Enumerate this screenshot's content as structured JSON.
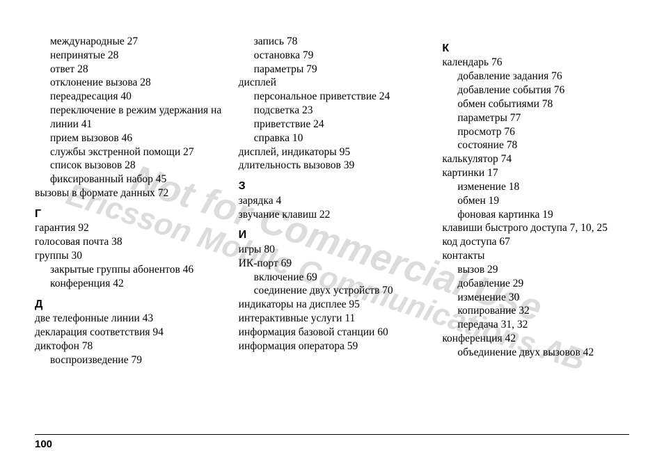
{
  "watermark": {
    "line1": "Not for Commercial Use",
    "line2": "Ericsson Mobile Communications AB"
  },
  "page_number": "100",
  "columns": [
    [
      {
        "kind": "entry",
        "indent": 1,
        "text": "международные 27"
      },
      {
        "kind": "entry",
        "indent": 1,
        "text": "непринятые 28"
      },
      {
        "kind": "entry",
        "indent": 1,
        "text": "ответ 28"
      },
      {
        "kind": "entry",
        "indent": 1,
        "text": "отклонение вызова 28"
      },
      {
        "kind": "entry",
        "indent": 1,
        "text": "переадресация 40"
      },
      {
        "kind": "entry",
        "indent": 1,
        "text": "переключение в режим удержания на линии 41"
      },
      {
        "kind": "entry",
        "indent": 1,
        "text": "прием вызовов 46"
      },
      {
        "kind": "entry",
        "indent": 1,
        "text": "службы экстренной помощи 27"
      },
      {
        "kind": "entry",
        "indent": 1,
        "text": "список вызовов 28"
      },
      {
        "kind": "entry",
        "indent": 1,
        "text": "фиксированный набор 45"
      },
      {
        "kind": "entry",
        "indent": 0,
        "text": "вызовы в формате данных 72"
      },
      {
        "kind": "letter",
        "text": "Г"
      },
      {
        "kind": "entry",
        "indent": 0,
        "text": "гарантия 92"
      },
      {
        "kind": "entry",
        "indent": 0,
        "text": "голосовая почта 38"
      },
      {
        "kind": "entry",
        "indent": 0,
        "text": "группы 30"
      },
      {
        "kind": "entry",
        "indent": 1,
        "text": "закрытые группы абонентов 46"
      },
      {
        "kind": "entry",
        "indent": 1,
        "text": "конференция 42"
      },
      {
        "kind": "letter",
        "text": "Д"
      },
      {
        "kind": "entry",
        "indent": 0,
        "text": "две телефонные линии 43"
      },
      {
        "kind": "entry",
        "indent": 0,
        "text": "декларация соответствия 94"
      },
      {
        "kind": "entry",
        "indent": 0,
        "text": "диктофон 78"
      },
      {
        "kind": "entry",
        "indent": 1,
        "text": "воспроизведение 79"
      }
    ],
    [
      {
        "kind": "entry",
        "indent": 1,
        "text": "запись 78"
      },
      {
        "kind": "entry",
        "indent": 1,
        "text": "остановка 79"
      },
      {
        "kind": "entry",
        "indent": 1,
        "text": "параметры 79"
      },
      {
        "kind": "entry",
        "indent": 0,
        "text": "дисплей"
      },
      {
        "kind": "entry",
        "indent": 1,
        "text": "персональное приветствие 24"
      },
      {
        "kind": "entry",
        "indent": 1,
        "text": "подсветка 23"
      },
      {
        "kind": "entry",
        "indent": 1,
        "text": "приветствие 24"
      },
      {
        "kind": "entry",
        "indent": 1,
        "text": "справка 10"
      },
      {
        "kind": "entry",
        "indent": 0,
        "text": "дисплей, индикаторы 95"
      },
      {
        "kind": "entry",
        "indent": 0,
        "text": "длительность вызовов 39"
      },
      {
        "kind": "letter",
        "text": "З"
      },
      {
        "kind": "entry",
        "indent": 0,
        "text": "зарядка 4"
      },
      {
        "kind": "entry",
        "indent": 0,
        "text": "звучание клавиш 22"
      },
      {
        "kind": "letter",
        "text": "И"
      },
      {
        "kind": "entry",
        "indent": 0,
        "text": "игры 80"
      },
      {
        "kind": "entry",
        "indent": 0,
        "text": "ИК-порт 69"
      },
      {
        "kind": "entry",
        "indent": 1,
        "text": "включение 69"
      },
      {
        "kind": "entry",
        "indent": 1,
        "text": "соединение двух устройств 70"
      },
      {
        "kind": "entry",
        "indent": 0,
        "text": "индикаторы на дисплее 95"
      },
      {
        "kind": "entry",
        "indent": 0,
        "text": "интерактивные услуги 11"
      },
      {
        "kind": "entry",
        "indent": 0,
        "text": "информация базовой станции 60"
      },
      {
        "kind": "entry",
        "indent": 0,
        "text": "информация оператора 59"
      }
    ],
    [
      {
        "kind": "letter",
        "text": "К"
      },
      {
        "kind": "entry",
        "indent": 0,
        "text": "календарь 76"
      },
      {
        "kind": "entry",
        "indent": 1,
        "text": "добавление задания 76"
      },
      {
        "kind": "entry",
        "indent": 1,
        "text": "добавление события 76"
      },
      {
        "kind": "entry",
        "indent": 1,
        "text": "обмен событиями 78"
      },
      {
        "kind": "entry",
        "indent": 1,
        "text": "параметры 77"
      },
      {
        "kind": "entry",
        "indent": 1,
        "text": "просмотр 76"
      },
      {
        "kind": "entry",
        "indent": 1,
        "text": "состояние 78"
      },
      {
        "kind": "entry",
        "indent": 0,
        "text": "калькулятор 74"
      },
      {
        "kind": "entry",
        "indent": 0,
        "text": "картинки 17"
      },
      {
        "kind": "entry",
        "indent": 1,
        "text": "изменение 18"
      },
      {
        "kind": "entry",
        "indent": 1,
        "text": "обмен 19"
      },
      {
        "kind": "entry",
        "indent": 1,
        "text": "фоновая картинка 19"
      },
      {
        "kind": "entry",
        "indent": 0,
        "text": "клавиши быстрого доступа 7, 10, 25"
      },
      {
        "kind": "entry",
        "indent": 0,
        "text": "код доступа 67"
      },
      {
        "kind": "entry",
        "indent": 0,
        "text": "контакты"
      },
      {
        "kind": "entry",
        "indent": 1,
        "text": "вызов 29"
      },
      {
        "kind": "entry",
        "indent": 1,
        "text": "добавление 29"
      },
      {
        "kind": "entry",
        "indent": 1,
        "text": "изменение 30"
      },
      {
        "kind": "entry",
        "indent": 1,
        "text": "копирование 32"
      },
      {
        "kind": "entry",
        "indent": 1,
        "text": "передача 31, 32"
      },
      {
        "kind": "entry",
        "indent": 0,
        "text": "конференция 42"
      },
      {
        "kind": "entry",
        "indent": 1,
        "text": "объединение двух вызовов 42"
      }
    ]
  ]
}
